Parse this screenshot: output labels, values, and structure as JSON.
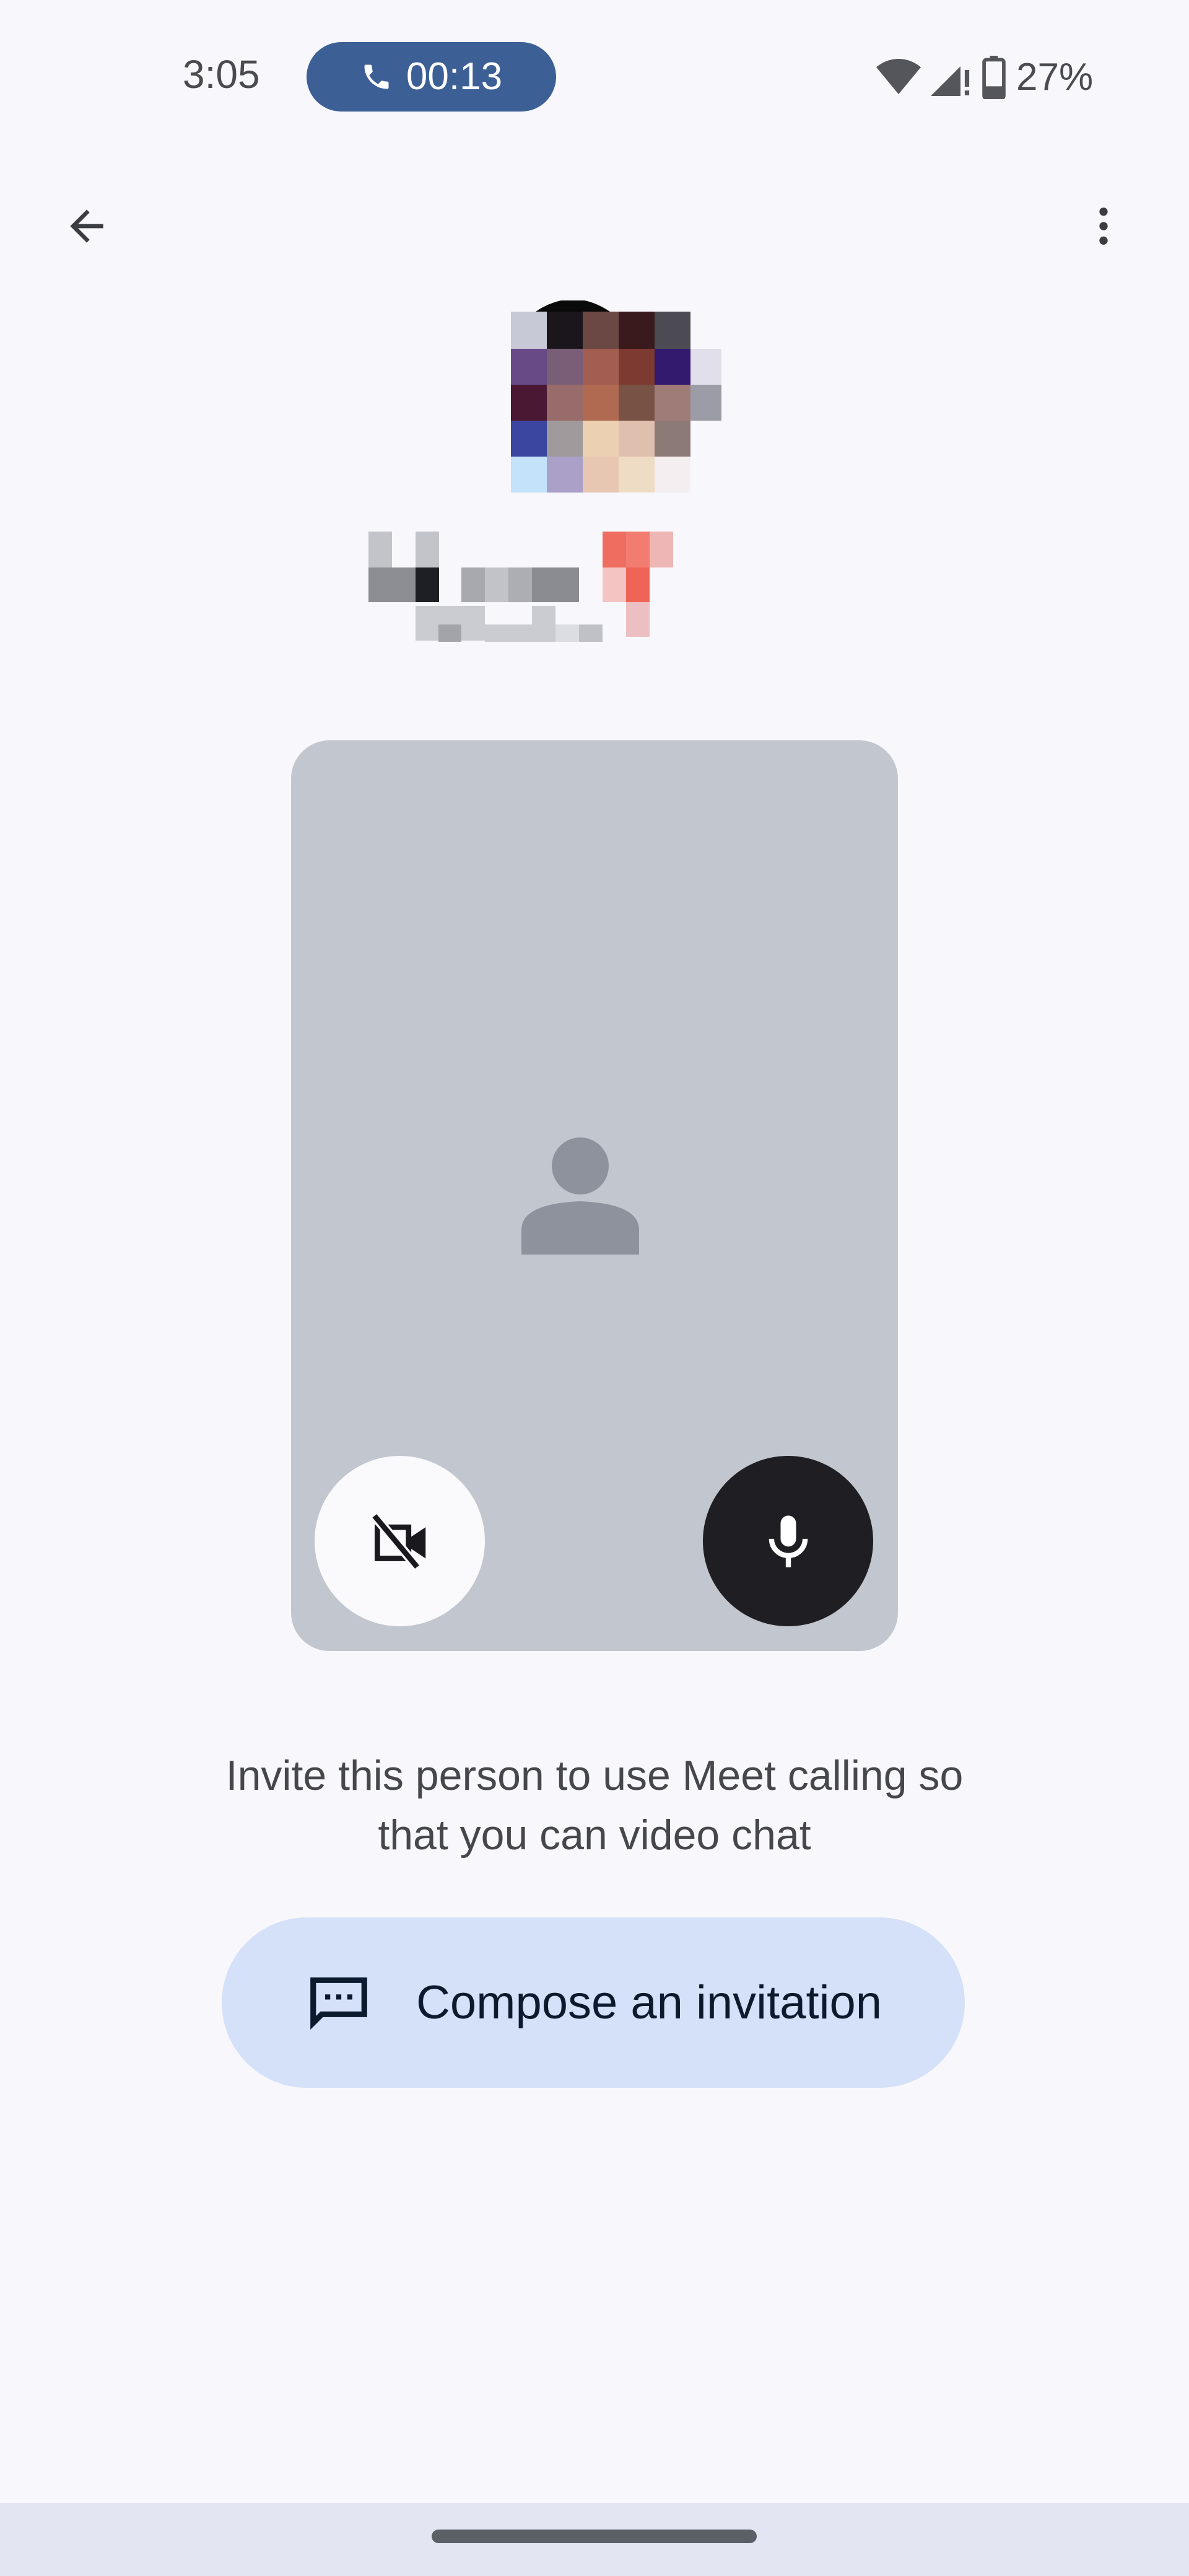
{
  "status_bar": {
    "time": "3:05",
    "call_chip": {
      "icon": "phone-icon",
      "duration": "00:13",
      "color": "#3c5f96"
    },
    "icons": [
      "wifi-icon",
      "cellular-signal-alert-icon",
      "battery-icon"
    ],
    "battery_percent": "27%"
  },
  "top_bar": {
    "back_icon": "arrow-back-icon",
    "menu_icon": "more-vert-icon"
  },
  "contact": {
    "avatar": "pixelated-contact-photo",
    "name": "[redacted]",
    "subtitle": "[redacted]"
  },
  "preview": {
    "placeholder_icon": "person-icon",
    "camera_button": {
      "icon": "videocam-off-icon",
      "state": "off"
    },
    "mic_button": {
      "icon": "mic-icon",
      "state": "on"
    },
    "card_color": "#c2c6cf"
  },
  "message": {
    "line1": "Invite this person to use Meet calling so",
    "line2": "that you can video chat"
  },
  "compose_button": {
    "icon": "chat-bubble-dots-icon",
    "label": "Compose an invitation",
    "color": "#d5e1f8"
  },
  "nav": {
    "handle": "gesture-nav-handle"
  }
}
